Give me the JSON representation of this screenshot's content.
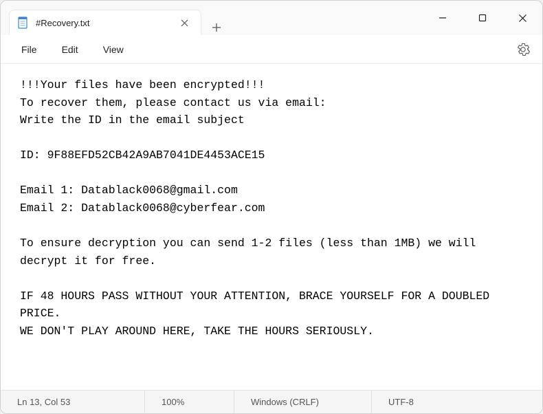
{
  "tab": {
    "title": "#Recovery.txt"
  },
  "menu": {
    "file": "File",
    "edit": "Edit",
    "view": "View"
  },
  "content": "!!!Your files have been encrypted!!!\nTo recover them, please contact us via email:\nWrite the ID in the email subject\n\nID: 9F88EFD52CB42A9AB7041DE4453ACE15\n\nEmail 1: Datablack0068@gmail.com\nEmail 2: Datablack0068@cyberfear.com\n\nTo ensure decryption you can send 1-2 files (less than 1MB) we will decrypt it for free.\n\nIF 48 HOURS PASS WITHOUT YOUR ATTENTION, BRACE YOURSELF FOR A DOUBLED PRICE.\nWE DON'T PLAY AROUND HERE, TAKE THE HOURS SERIOUSLY.",
  "status": {
    "caret": "Ln 13, Col 53",
    "zoom": "100%",
    "eol": "Windows (CRLF)",
    "encoding": "UTF-8"
  }
}
